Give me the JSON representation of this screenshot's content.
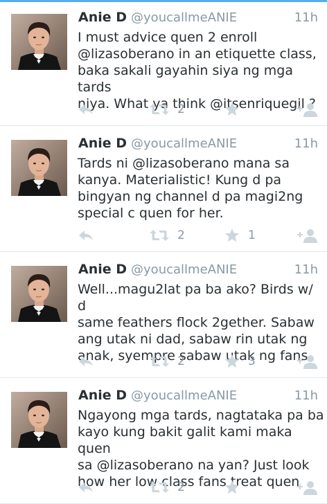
{
  "tweets": [
    {
      "name": "Anie D",
      "handle": "@youcallmeANIE",
      "time": "11h",
      "text": "I must advice quen 2 enroll\n@lizasoberano in an etiquette class,\nbaka sakali gayahin siya ng mga tards\nniya. What ya think @itsenriquegil ?",
      "retweets": "2",
      "favorites": ""
    },
    {
      "name": "Anie D",
      "handle": "@youcallmeANIE",
      "time": "11h",
      "text": "Tards ni @lizasoberano mana sa\nkanya. Materialistic! Kung d pa\nbingyan ng channel d pa magi2ng\nspecial c quen for her.",
      "retweets": "2",
      "favorites": "1"
    },
    {
      "name": "Anie D",
      "handle": "@youcallmeANIE",
      "time": "11h",
      "text": "Well...magu2lat pa ba ako? Birds w/ d\nsame feathers flock 2gether. Sabaw\nang utak ni dad, sabaw rin utak ng\nanak, syempre sabaw utak ng fans",
      "retweets": "2",
      "favorites": "3"
    },
    {
      "name": "Anie D",
      "handle": "@youcallmeANIE",
      "time": "11h",
      "text": "Ngayong mga tards, nagtataka pa ba\nkayo kung bakit galit kami maka quen\nsa @lizasoberano na yan? Just look\nhow her low class fans treat quen",
      "retweets": "2",
      "favorites": ""
    }
  ],
  "icons": {
    "reply": "reply-icon",
    "retweet": "retweet-icon",
    "favorite": "star-icon",
    "follow": "follow-user-icon",
    "avatar": "profile-photo"
  },
  "colors": {
    "accent": "#55acee",
    "icon": "#ccd6dd",
    "muted": "#8899a6",
    "text": "#292f33",
    "divider": "#e1e8ed"
  }
}
